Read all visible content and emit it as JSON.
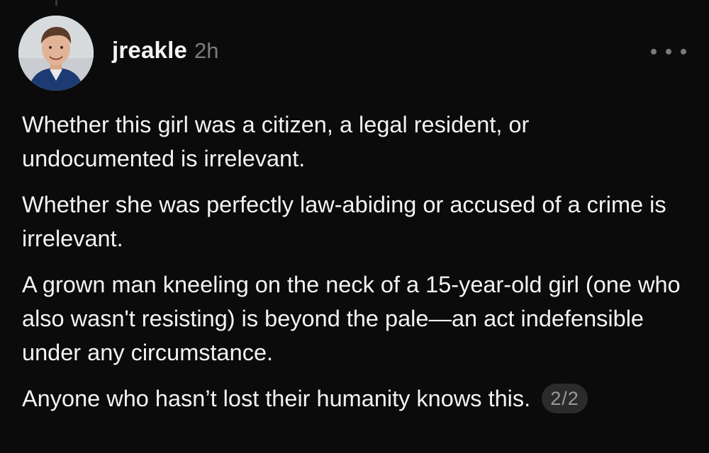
{
  "post": {
    "username": "jreakle",
    "timestamp": "2h",
    "paragraphs": [
      "Whether this girl was a citizen, a legal resident, or undocumented is irrelevant.",
      "Whether she was perfectly law-abiding or accused of a crime is irrelevant.",
      "A grown man kneeling on the neck of a 15-year-old girl (one who also wasn't resisting) is beyond the pale—an act indefensible under any circumstance.",
      "Anyone who hasn’t lost their humanity knows this."
    ],
    "page_indicator": "2/2"
  },
  "icons": {
    "more": "more-horizontal-icon",
    "avatar": "user-avatar"
  },
  "colors": {
    "background": "#0b0b0b",
    "text": "#f3f3f3",
    "muted": "#7c7c7c",
    "badge_bg": "#2b2b2b"
  }
}
